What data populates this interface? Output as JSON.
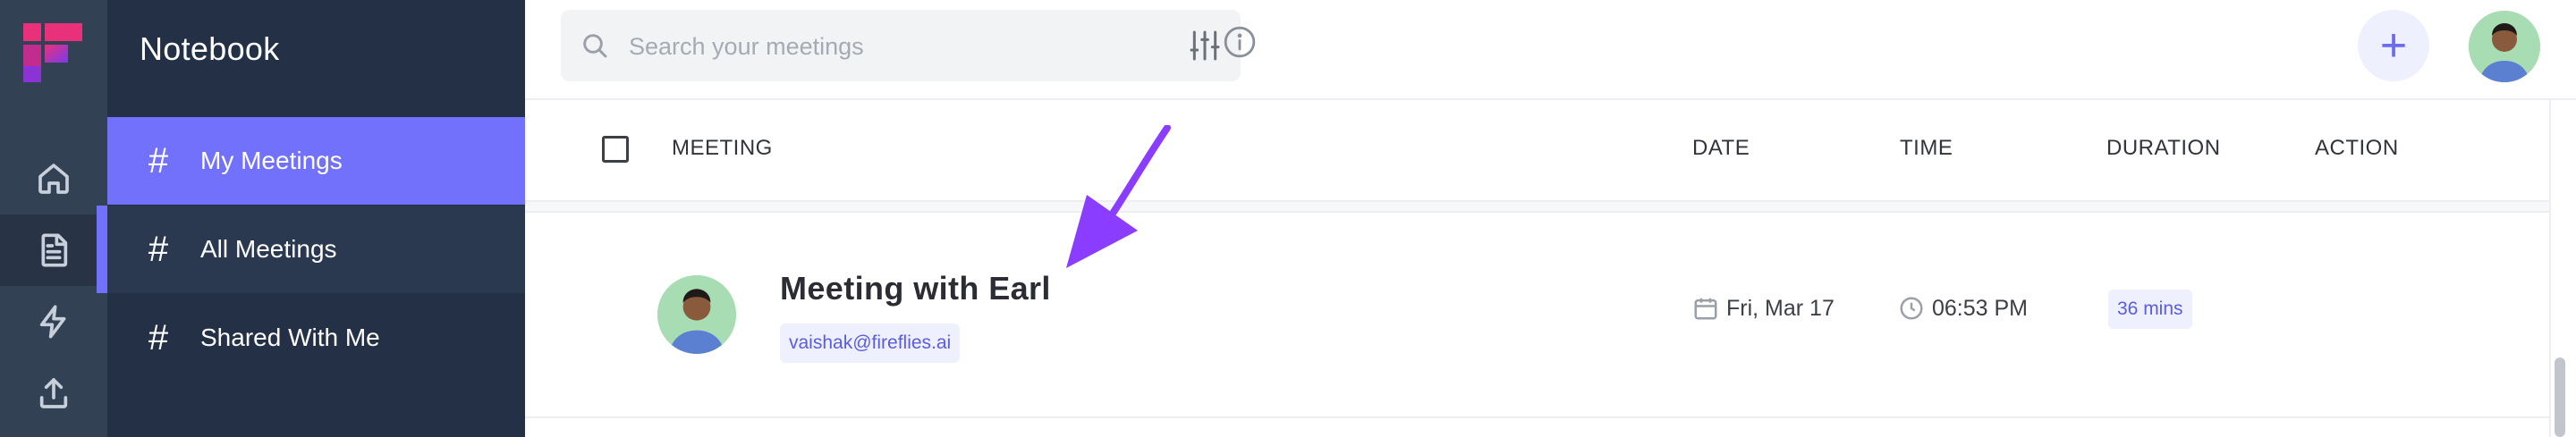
{
  "app": {
    "section_title": "Notebook"
  },
  "rail": {
    "items": [
      {
        "icon": "home-icon",
        "active": false
      },
      {
        "icon": "notebook-icon",
        "active": true
      },
      {
        "icon": "lightning-icon",
        "active": false
      },
      {
        "icon": "upload-icon",
        "active": false
      }
    ]
  },
  "sidebar": {
    "items": [
      {
        "label": "My Meetings",
        "state": "selected"
      },
      {
        "label": "All Meetings",
        "state": "hovered"
      },
      {
        "label": "Shared With Me",
        "state": "normal"
      }
    ]
  },
  "search": {
    "placeholder": "Search your meetings",
    "value": ""
  },
  "table": {
    "columns": {
      "meeting": "MEETING",
      "date": "DATE",
      "time": "TIME",
      "duration": "DURATION",
      "action": "ACTION"
    },
    "rows": [
      {
        "title": "Meeting with Earl",
        "email": "vaishak@fireflies.ai",
        "date": "Fri, Mar 17",
        "time": "06:53 PM",
        "duration": "36 mins"
      }
    ]
  },
  "colors": {
    "accent": "#7271fb",
    "sidebar_bg": "#233045",
    "rail_bg": "#334155",
    "badge_bg": "#eef0fd",
    "badge_text": "#5b5ce0",
    "annotation_arrow": "#8b3dff"
  }
}
